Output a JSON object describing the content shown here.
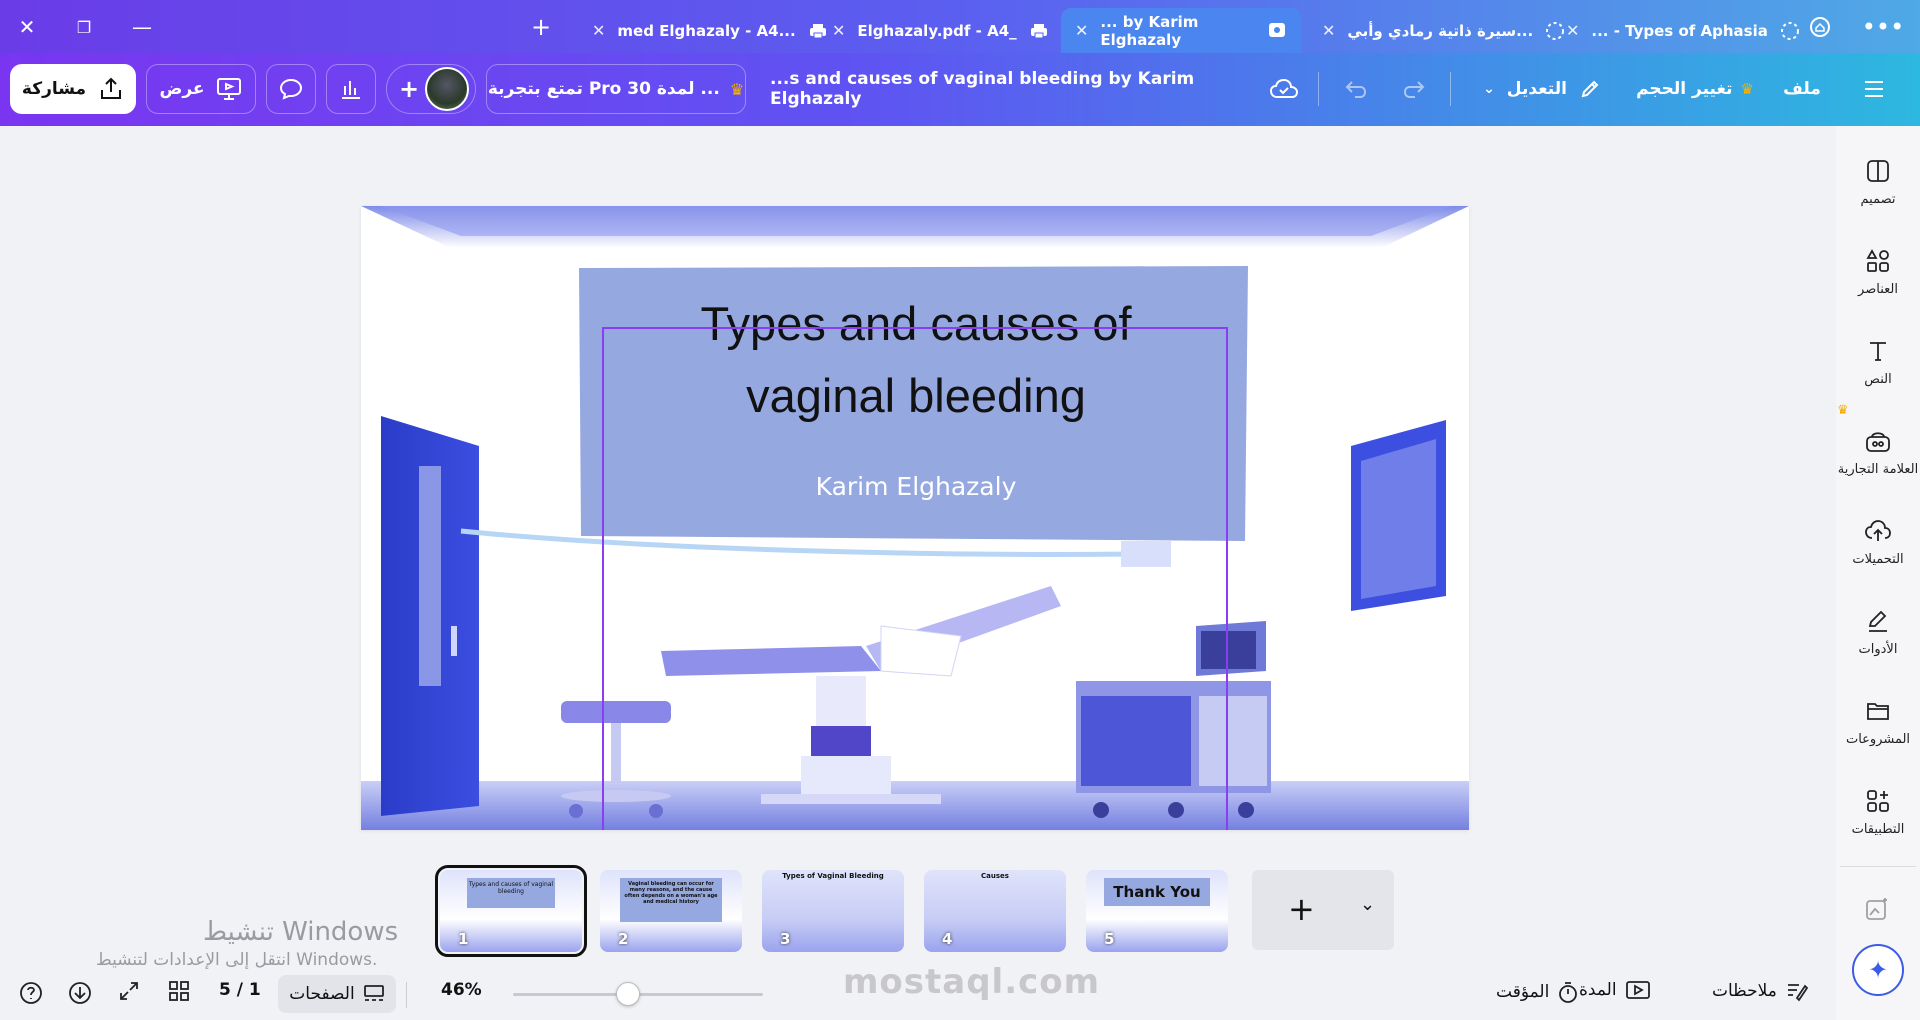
{
  "tabs": [
    {
      "title": "med Elghazaly - A4..."
    },
    {
      "title": "Elghazaly.pdf - A4_"
    },
    {
      "title": "... by Karim Elghazaly"
    },
    {
      "title": "سيرة ذاتية رمادي وأبي..."
    },
    {
      "title": "... - Types of Aphasia"
    }
  ],
  "toolbar": {
    "share_label": "مشاركة",
    "present_label": "عرض",
    "trial_label": "تمتع بتجربة Pro لمدة 30 ...",
    "doc_title": "...s and causes of vaginal bleeding by Karim Elghazaly",
    "edit_label": "التعديل",
    "resize_label": "تغيير الحجم",
    "file_label": "ملف"
  },
  "rail": [
    {
      "label": "تصميم",
      "icon": "design-icon"
    },
    {
      "label": "العناصر",
      "icon": "elements-icon"
    },
    {
      "label": "النص",
      "icon": "text-icon"
    },
    {
      "label": "العلامة التجارية",
      "icon": "brand-icon"
    },
    {
      "label": "التحميلات",
      "icon": "upload-cloud-icon"
    },
    {
      "label": "الأدوات",
      "icon": "tools-icon"
    },
    {
      "label": "المشروعات",
      "icon": "folder-icon"
    },
    {
      "label": "التطبيقات",
      "icon": "apps-icon"
    }
  ],
  "slide": {
    "title_line1": "Types and causes of",
    "title_line2": "vaginal bleeding",
    "author": "Karim Elghazaly"
  },
  "thumbnails": [
    {
      "num": "1",
      "text": "Types and causes of vaginal bleeding"
    },
    {
      "num": "2",
      "text": "Vaginal bleeding can occur for many reasons, and the cause often depends on a woman's age and medical history"
    },
    {
      "num": "3",
      "text": "Types of Vaginal Bleeding"
    },
    {
      "num": "4",
      "text": "Causes"
    },
    {
      "num": "5",
      "text": "Thank You"
    }
  ],
  "bottom": {
    "notes_label": "ملاحظات",
    "duration_label": "المدة",
    "timer_label": "المؤقت",
    "zoom": "46%",
    "zoom_fraction": 0.46,
    "pages_label": "الصفحات",
    "page_indicator": "5 / 1"
  },
  "watermark": {
    "line1": "تنشيط Windows",
    "line2": "انتقل إلى الإعدادات لتنشيط Windows.",
    "site": "mostaql.com"
  },
  "colors": {
    "accent": "#7d2ae8",
    "slide_box": "#96a8e0",
    "room": "#5b63d8"
  }
}
